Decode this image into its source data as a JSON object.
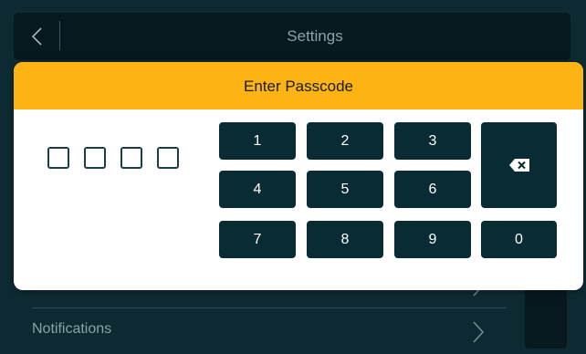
{
  "header": {
    "title": "Settings"
  },
  "list": {
    "items": [
      {
        "label": ""
      },
      {
        "label": "Notifications"
      }
    ]
  },
  "modal": {
    "title": "Enter Passcode",
    "digits_entered": 0,
    "digits_total": 4,
    "keys": [
      "1",
      "2",
      "3",
      "4",
      "5",
      "6",
      "7",
      "8",
      "9",
      "0"
    ]
  },
  "icons": {
    "back": "chevron-left-icon",
    "backspace": "backspace-icon",
    "row_chevron": "chevron-right-icon"
  },
  "colors": {
    "background": "#0d2a33",
    "header_bg": "#07191f",
    "modal_header": "#fbb414",
    "key_bg": "#092b33",
    "key_text": "#ffffff"
  }
}
